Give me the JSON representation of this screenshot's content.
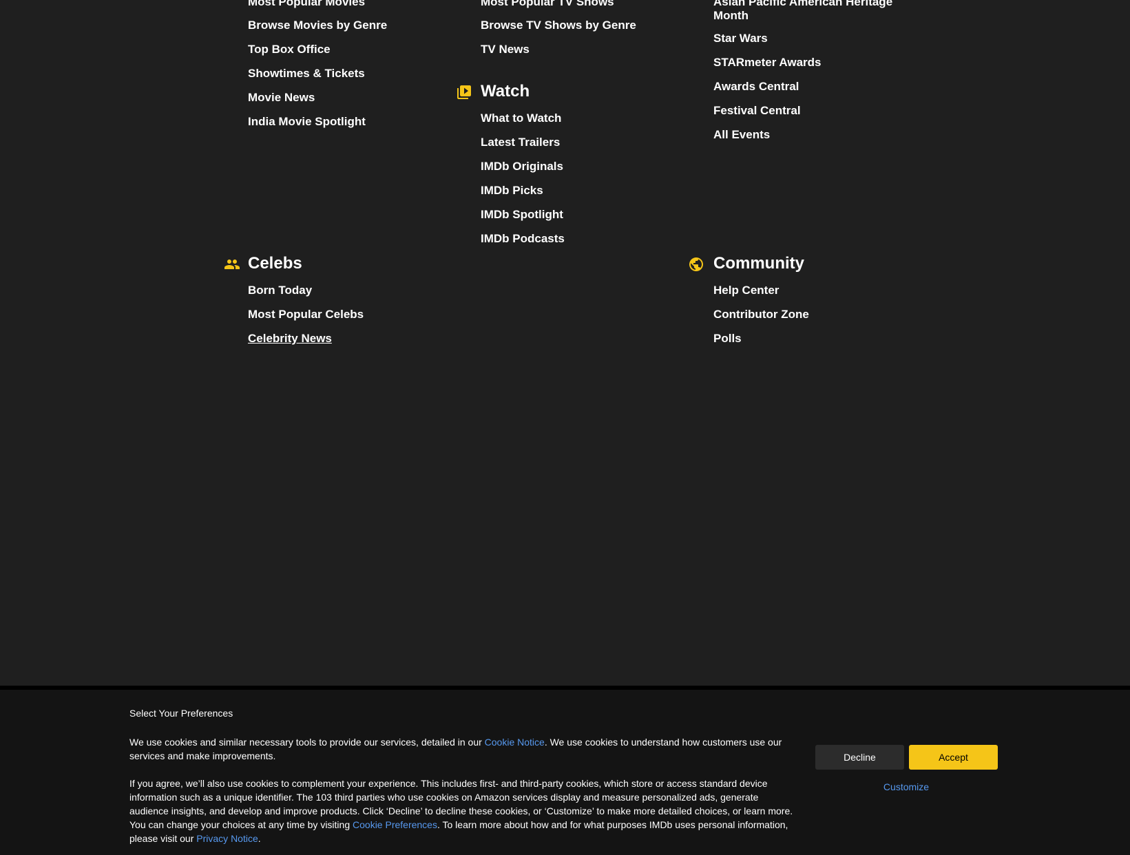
{
  "menu": {
    "movies": {
      "links": [
        "Most Popular Movies",
        "Browse Movies by Genre",
        "Top Box Office",
        "Showtimes & Tickets",
        "Movie News",
        "India Movie Spotlight"
      ]
    },
    "tv": {
      "links": [
        "Most Popular TV Shows",
        "Browse TV Shows by Genre",
        "TV News"
      ]
    },
    "watch": {
      "title": "Watch",
      "links": [
        "What to Watch",
        "Latest Trailers",
        "IMDb Originals",
        "IMDb Picks",
        "IMDb Spotlight",
        "IMDb Podcasts"
      ]
    },
    "events": {
      "links": [
        "Asian Pacific American Heritage Month",
        "Star Wars",
        "STARmeter Awards",
        "Awards Central",
        "Festival Central",
        "All Events"
      ]
    },
    "celebs": {
      "title": "Celebs",
      "links": [
        "Born Today",
        "Most Popular Celebs",
        "Celebrity News"
      ]
    },
    "community": {
      "title": "Community",
      "links": [
        "Help Center",
        "Contributor Zone",
        "Polls"
      ]
    }
  },
  "icons": {
    "watch": "play-video-icon",
    "celebs": "people-icon",
    "community": "globe-icon",
    "accent_color": "#f5c518"
  },
  "cookie_banner": {
    "title": "Select Your Preferences",
    "p1_before": "We use cookies and similar necessary tools to provide our services, detailed in our ",
    "p1_link": "Cookie Notice",
    "p1_after": ". We use cookies to understand how customers use our services and make improvements.",
    "p2_before": "If you agree, we’ll also use cookies to complement your experience. This includes first- and third-party cookies, which store or access standard device information such as a unique identifier. The 103 third parties who use cookies on Amazon services display and measure personalized ads, generate audience insights, and develop and improve products. Click ‘Decline’ to decline these cookies, or ‘Customize’ to make more detailed choices, or learn more. You can change your choices at any time by visiting ",
    "p2_link1": "Cookie Preferences",
    "p2_middle": ". To learn more about how and for what purposes IMDb uses personal information, please visit our ",
    "p2_link2": "Privacy Notice",
    "p2_after": ".",
    "decline_label": "Decline",
    "accept_label": "Accept",
    "customize_label": "Customize",
    "link_color": "#5799ef"
  }
}
